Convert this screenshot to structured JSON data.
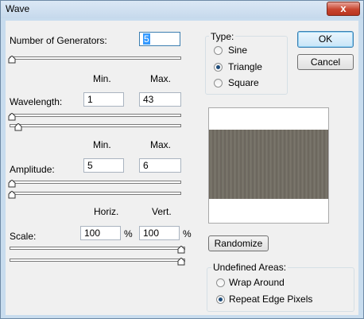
{
  "window": {
    "title": "Wave",
    "close_glyph": "x"
  },
  "generators": {
    "label": "Number of Generators:",
    "value": "5"
  },
  "wavelength": {
    "min_header": "Min.",
    "max_header": "Max.",
    "label": "Wavelength:",
    "min": "1",
    "max": "43",
    "min_slider": 0.0,
    "max_slider": 0.04
  },
  "amplitude": {
    "min_header": "Min.",
    "max_header": "Max.",
    "label": "Amplitude:",
    "min": "5",
    "max": "6",
    "min_slider": 0.0,
    "max_slider": 0.0
  },
  "scale": {
    "horiz_header": "Horiz.",
    "vert_header": "Vert.",
    "label": "Scale:",
    "horiz": "100",
    "vert": "100",
    "unit": "%",
    "horiz_slider": 1.0,
    "vert_slider": 1.0
  },
  "type": {
    "title": "Type:",
    "options": [
      "Sine",
      "Triangle",
      "Square"
    ],
    "selected": "Triangle"
  },
  "buttons": {
    "ok": "OK",
    "cancel": "Cancel",
    "randomize": "Randomize"
  },
  "undefined_areas": {
    "title": "Undefined Areas:",
    "options": [
      "Wrap Around",
      "Repeat Edge Pixels"
    ],
    "selected": "Repeat Edge Pixels"
  }
}
